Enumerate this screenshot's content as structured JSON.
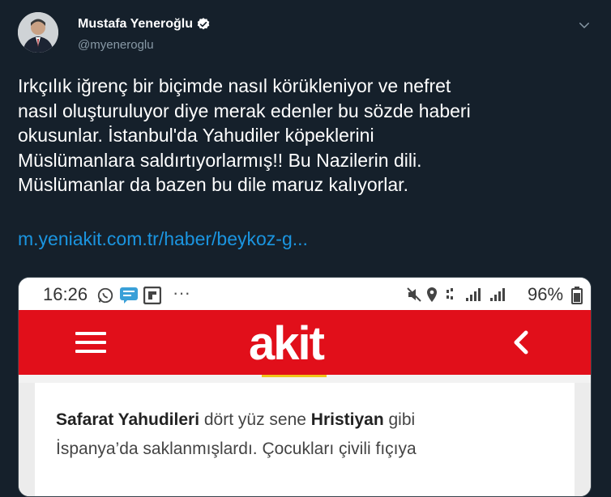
{
  "author": {
    "display_name": "Mustafa Yeneroğlu",
    "handle": "@myeneroglu"
  },
  "tweet": {
    "lines": [
      "Irkçılık iğrenç bir biçimde nasıl körükleniyor ve nefret",
      "nasıl oluşturuluyor diye merak edenler bu sözde haberi",
      "okusunlar. İstanbul'da Yahudiler köpeklerini",
      "Müslümanlara saldırtıyorlarmış!! Bu Nazilerin dili.",
      "Müslümanlar da bazen bu dile maruz kalıyorlar."
    ],
    "link": "m.yeniakit.com.tr/haber/beykoz-g..."
  },
  "media": {
    "status_time": "16:26",
    "status_dots": "···",
    "battery": "96%",
    "logo": "akit",
    "article": {
      "bold1": "Safarat Yahudileri",
      "text1": " dört yüz sene ",
      "bold2": "Hristiyan",
      "text2": " gibi",
      "line2": "İspanya’da saklanmışlardı. Çocukları çivili fıçıya"
    }
  },
  "colors": {
    "background": "#15202b",
    "link": "#1b95e0",
    "brand_red": "#e10f1a",
    "verified": "#ffffff"
  },
  "icons": [
    "verified-badge-icon",
    "chevron-down-icon",
    "whatsapp-icon",
    "message-icon",
    "flipboard-icon",
    "mute-icon",
    "location-icon",
    "signal-icon",
    "battery-icon",
    "hamburger-menu-icon",
    "back-arrow-icon"
  ]
}
